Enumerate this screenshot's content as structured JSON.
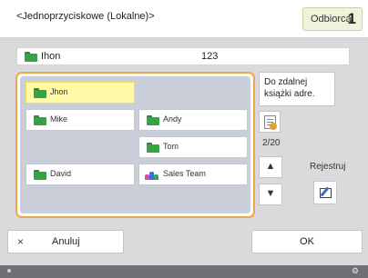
{
  "header": {
    "title": "<Jednoprzyciskowe (Lokalne)>",
    "recipient_label": "Odbiorca",
    "recipient_count": "1"
  },
  "selected": {
    "name": "Ihon",
    "number": "123",
    "icon": "folder-icon"
  },
  "entries": [
    {
      "label": "Jhon",
      "icon": "folder-icon",
      "selected": true
    },
    {
      "label": "Mike",
      "icon": "folder-icon",
      "selected": false
    },
    {
      "label": "Andy",
      "icon": "folder-icon",
      "selected": false
    },
    {
      "label": "Tom",
      "icon": "folder-icon",
      "selected": false
    },
    {
      "label": "David",
      "icon": "folder-icon",
      "selected": false
    },
    {
      "label": "Sales Team",
      "icon": "group-icon",
      "selected": false
    }
  ],
  "side": {
    "remote_label": "Do zdalnej książki adre.",
    "page_indicator": "2/20",
    "up_icon": "up-arrow-icon",
    "down_icon": "down-arrow-icon",
    "register_label": "Rejestruj"
  },
  "footer": {
    "cancel_icon": "×",
    "cancel_label": "Anuluj",
    "ok_label": "OK"
  },
  "colors": {
    "accent_frame": "#f2a44b",
    "selected_entry": "#fff9a8",
    "folder_green": "#36a145",
    "recipient_badge": "#eef3dd"
  }
}
